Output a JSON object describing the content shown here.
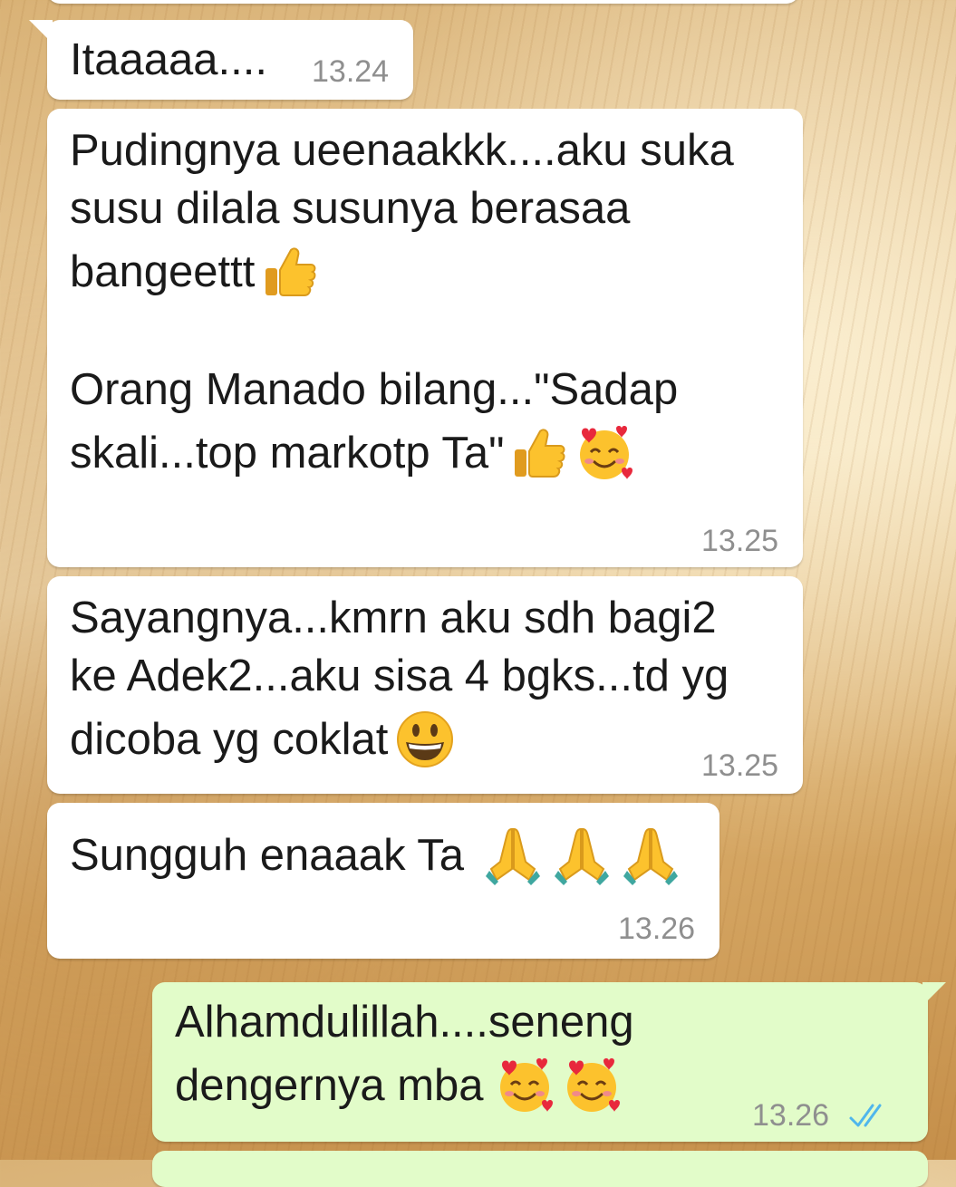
{
  "chat": {
    "messages": [
      {
        "direction": "incoming",
        "text": "Itaaaaa....",
        "time": "13.24",
        "emojis": []
      },
      {
        "direction": "incoming",
        "line1": "Pudingnya ueenaakkk....aku suka",
        "line2": "susu dilala susunya berasaa",
        "line3": "bangeettt",
        "line4": "Orang Manado bilang...\"Sadap",
        "line5": "skali...top markotp Ta\"",
        "time": "13.25",
        "emojis": [
          "thumbs-up-icon",
          "thumbs-up-icon",
          "smiling-face-with-hearts-icon"
        ]
      },
      {
        "direction": "incoming",
        "line1": "Sayangnya...kmrn aku sdh bagi2",
        "line2": "ke Adek2...aku sisa 4 bgks...td yg",
        "line3": "dicoba yg coklat",
        "time": "13.25",
        "emojis": [
          "grinning-face-icon"
        ]
      },
      {
        "direction": "incoming",
        "text": "Sungguh enaaak Ta",
        "time": "13.26",
        "emojis": [
          "folded-hands-icon",
          "folded-hands-icon",
          "folded-hands-icon"
        ]
      },
      {
        "direction": "outgoing",
        "line1": "Alhamdulillah....seneng",
        "line2": "dengernya mba",
        "time": "13.26",
        "status": "read",
        "emojis": [
          "smiling-face-with-hearts-icon",
          "smiling-face-with-hearts-icon"
        ]
      }
    ]
  },
  "colors": {
    "incoming_bubble": "#ffffff",
    "outgoing_bubble": "#e2fcc9",
    "timestamp": "#8f8f8f",
    "read_ticks": "#4fb6ec"
  }
}
